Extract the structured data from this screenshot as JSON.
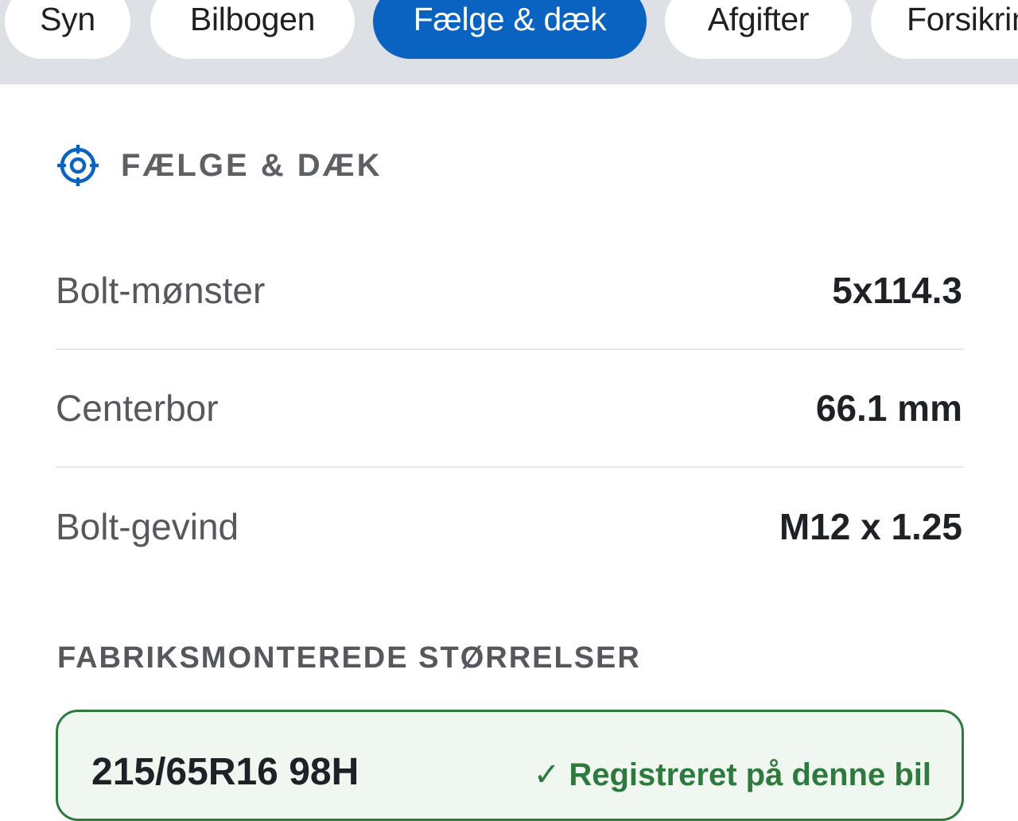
{
  "tabs": [
    {
      "label": "Syn",
      "active": false
    },
    {
      "label": "Bilbogen",
      "active": false
    },
    {
      "label": "Fælge & dæk",
      "active": true
    },
    {
      "label": "Afgifter",
      "active": false
    },
    {
      "label": "Forsikring",
      "active": false
    }
  ],
  "section": {
    "title": "FÆLGE & DÆK",
    "icon": "target-icon",
    "accent_color": "#0a63c1"
  },
  "specs": [
    {
      "label": "Bolt-mønster",
      "value": "5x114.3"
    },
    {
      "label": "Centerbor",
      "value": "66.1 mm"
    },
    {
      "label": "Bolt-gevind",
      "value": "M12 x 1.25"
    }
  ],
  "factory_sizes": {
    "title": "FABRIKSMONTEREDE STØRRELSER",
    "items": [
      {
        "size": "215/65R16 98H",
        "badge": "✓ Registreret på denne bil"
      }
    ],
    "card_color": "#2e7a3e"
  }
}
